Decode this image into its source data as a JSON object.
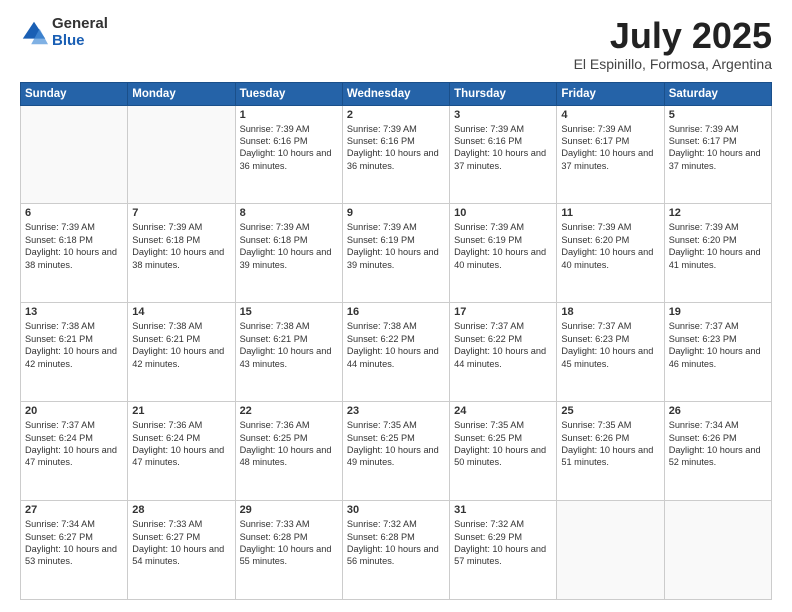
{
  "header": {
    "logo_general": "General",
    "logo_blue": "Blue",
    "month_title": "July 2025",
    "subtitle": "El Espinillo, Formosa, Argentina"
  },
  "days_of_week": [
    "Sunday",
    "Monday",
    "Tuesday",
    "Wednesday",
    "Thursday",
    "Friday",
    "Saturday"
  ],
  "weeks": [
    [
      {
        "day": "",
        "content": ""
      },
      {
        "day": "",
        "content": ""
      },
      {
        "day": "1",
        "content": "Sunrise: 7:39 AM\nSunset: 6:16 PM\nDaylight: 10 hours and 36 minutes."
      },
      {
        "day": "2",
        "content": "Sunrise: 7:39 AM\nSunset: 6:16 PM\nDaylight: 10 hours and 36 minutes."
      },
      {
        "day": "3",
        "content": "Sunrise: 7:39 AM\nSunset: 6:16 PM\nDaylight: 10 hours and 37 minutes."
      },
      {
        "day": "4",
        "content": "Sunrise: 7:39 AM\nSunset: 6:17 PM\nDaylight: 10 hours and 37 minutes."
      },
      {
        "day": "5",
        "content": "Sunrise: 7:39 AM\nSunset: 6:17 PM\nDaylight: 10 hours and 37 minutes."
      }
    ],
    [
      {
        "day": "6",
        "content": "Sunrise: 7:39 AM\nSunset: 6:18 PM\nDaylight: 10 hours and 38 minutes."
      },
      {
        "day": "7",
        "content": "Sunrise: 7:39 AM\nSunset: 6:18 PM\nDaylight: 10 hours and 38 minutes."
      },
      {
        "day": "8",
        "content": "Sunrise: 7:39 AM\nSunset: 6:18 PM\nDaylight: 10 hours and 39 minutes."
      },
      {
        "day": "9",
        "content": "Sunrise: 7:39 AM\nSunset: 6:19 PM\nDaylight: 10 hours and 39 minutes."
      },
      {
        "day": "10",
        "content": "Sunrise: 7:39 AM\nSunset: 6:19 PM\nDaylight: 10 hours and 40 minutes."
      },
      {
        "day": "11",
        "content": "Sunrise: 7:39 AM\nSunset: 6:20 PM\nDaylight: 10 hours and 40 minutes."
      },
      {
        "day": "12",
        "content": "Sunrise: 7:39 AM\nSunset: 6:20 PM\nDaylight: 10 hours and 41 minutes."
      }
    ],
    [
      {
        "day": "13",
        "content": "Sunrise: 7:38 AM\nSunset: 6:21 PM\nDaylight: 10 hours and 42 minutes."
      },
      {
        "day": "14",
        "content": "Sunrise: 7:38 AM\nSunset: 6:21 PM\nDaylight: 10 hours and 42 minutes."
      },
      {
        "day": "15",
        "content": "Sunrise: 7:38 AM\nSunset: 6:21 PM\nDaylight: 10 hours and 43 minutes."
      },
      {
        "day": "16",
        "content": "Sunrise: 7:38 AM\nSunset: 6:22 PM\nDaylight: 10 hours and 44 minutes."
      },
      {
        "day": "17",
        "content": "Sunrise: 7:37 AM\nSunset: 6:22 PM\nDaylight: 10 hours and 44 minutes."
      },
      {
        "day": "18",
        "content": "Sunrise: 7:37 AM\nSunset: 6:23 PM\nDaylight: 10 hours and 45 minutes."
      },
      {
        "day": "19",
        "content": "Sunrise: 7:37 AM\nSunset: 6:23 PM\nDaylight: 10 hours and 46 minutes."
      }
    ],
    [
      {
        "day": "20",
        "content": "Sunrise: 7:37 AM\nSunset: 6:24 PM\nDaylight: 10 hours and 47 minutes."
      },
      {
        "day": "21",
        "content": "Sunrise: 7:36 AM\nSunset: 6:24 PM\nDaylight: 10 hours and 47 minutes."
      },
      {
        "day": "22",
        "content": "Sunrise: 7:36 AM\nSunset: 6:25 PM\nDaylight: 10 hours and 48 minutes."
      },
      {
        "day": "23",
        "content": "Sunrise: 7:35 AM\nSunset: 6:25 PM\nDaylight: 10 hours and 49 minutes."
      },
      {
        "day": "24",
        "content": "Sunrise: 7:35 AM\nSunset: 6:25 PM\nDaylight: 10 hours and 50 minutes."
      },
      {
        "day": "25",
        "content": "Sunrise: 7:35 AM\nSunset: 6:26 PM\nDaylight: 10 hours and 51 minutes."
      },
      {
        "day": "26",
        "content": "Sunrise: 7:34 AM\nSunset: 6:26 PM\nDaylight: 10 hours and 52 minutes."
      }
    ],
    [
      {
        "day": "27",
        "content": "Sunrise: 7:34 AM\nSunset: 6:27 PM\nDaylight: 10 hours and 53 minutes."
      },
      {
        "day": "28",
        "content": "Sunrise: 7:33 AM\nSunset: 6:27 PM\nDaylight: 10 hours and 54 minutes."
      },
      {
        "day": "29",
        "content": "Sunrise: 7:33 AM\nSunset: 6:28 PM\nDaylight: 10 hours and 55 minutes."
      },
      {
        "day": "30",
        "content": "Sunrise: 7:32 AM\nSunset: 6:28 PM\nDaylight: 10 hours and 56 minutes."
      },
      {
        "day": "31",
        "content": "Sunrise: 7:32 AM\nSunset: 6:29 PM\nDaylight: 10 hours and 57 minutes."
      },
      {
        "day": "",
        "content": ""
      },
      {
        "day": "",
        "content": ""
      }
    ]
  ]
}
